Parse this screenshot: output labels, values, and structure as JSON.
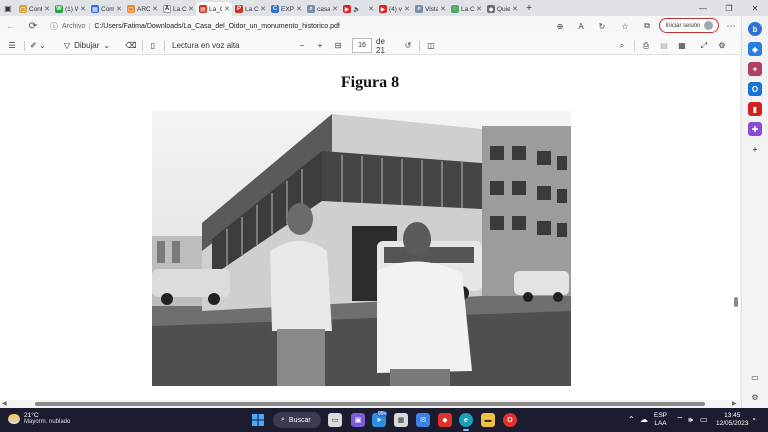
{
  "tabs": [
    {
      "label": "Cont",
      "color": "#d9a441",
      "glyph": "▢"
    },
    {
      "label": "(1) W",
      "color": "#25a244",
      "glyph": "W"
    },
    {
      "label": "Com",
      "color": "#2f6fd6",
      "glyph": "▦"
    },
    {
      "label": "ARC",
      "color": "#e98a3a",
      "glyph": "▢"
    },
    {
      "label": "La C",
      "color": "#ffffff",
      "glyph": "A"
    },
    {
      "label": "La_C",
      "color": "#c8341f",
      "glyph": "▤",
      "active": true
    },
    {
      "label": "La C",
      "color": "#c8341f",
      "glyph": "P"
    },
    {
      "label": "EXP",
      "color": "#2f6fd6",
      "glyph": "C"
    },
    {
      "label": "casa",
      "color": "#7a8fa6",
      "glyph": "⌕"
    },
    {
      "label": "",
      "color": "#e02020",
      "glyph": "▶",
      "extra": "🔈"
    },
    {
      "label": "(4) v",
      "color": "#e02020",
      "glyph": "▶"
    },
    {
      "label": "Vista",
      "color": "#7a8fa6",
      "glyph": "⌕"
    },
    {
      "label": "La C",
      "color": "#56a86a",
      "glyph": "◌"
    },
    {
      "label": "Quie",
      "color": "#6d6d6d",
      "glyph": "◆"
    }
  ],
  "window": {
    "minimize": "—",
    "maximize": "❐",
    "close": "✕"
  },
  "address": {
    "source_label": "Archivo",
    "url": "C:/Users/Fatima/Downloads/La_Casa_del_Oidor_un_monumento_historico.pdf",
    "signin_label": "Iniciar sesión"
  },
  "pdf_toolbar": {
    "draw_label": "Dibujar",
    "read_aloud_label": "Lectura en voz alta",
    "page_current": "16",
    "page_total": "de 21"
  },
  "document": {
    "figure_title": "Figura 8"
  },
  "taskbar": {
    "temperature": "21°C",
    "weather": "Mayorm. nublado",
    "search_label": "Buscar",
    "language": "ESP",
    "region": "LAA",
    "time": "13:45",
    "date": "12/05/2023",
    "notification_count": "99+"
  }
}
